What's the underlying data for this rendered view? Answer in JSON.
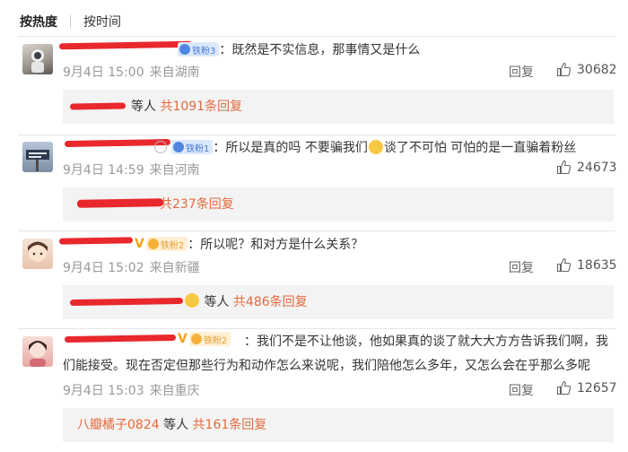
{
  "tabs": [
    {
      "label": "按热度",
      "active": true
    },
    {
      "label": "按时间",
      "active": false
    }
  ],
  "colors": {
    "link": "#e26b3e",
    "redaction": "#e8282d",
    "badge_blue": "#4479d6",
    "badge_gold": "#e39d2d"
  },
  "comments": [
    {
      "badge": "铁粉3",
      "badge_style": "blue",
      "text": "：既然是不实信息，那事情又是什么",
      "date": "9月4日 15:00",
      "location": "来自湖南",
      "reply_label": "回复",
      "likes": "30682",
      "sub": {
        "leading": "",
        "mid": "等人",
        "total": "共1091条回复"
      }
    },
    {
      "badge": "铁粉1",
      "badge_style": "blue",
      "text_a": "：所以是真的吗 不要骗我们",
      "text_b": "谈了不可怕 可怕的是一直骗着粉丝",
      "date": "9月4日 14:59",
      "location": "来自河南",
      "reply_label": "回复",
      "likes": "24673",
      "sub": {
        "leading": "",
        "mid": "",
        "total": "共237条回复"
      }
    },
    {
      "badge": "铁粉2",
      "badge_style": "gold",
      "verified": "V",
      "text": "：所以呢？和对方是什么关系？",
      "date": "9月4日 15:02",
      "location": "来自新疆",
      "reply_label": "回复",
      "likes": "18635",
      "sub": {
        "leading": "",
        "mid": "等人",
        "total": "共486条回复"
      }
    },
    {
      "badge": "铁粉2",
      "badge_style": "gold",
      "verified": "V",
      "text": "：我们不是不让他谈，他如果真的谈了就大大方方告诉我们啊，我们能接受。现在否定但那些行为和动作怎么来说呢，我们陪他怎么多年，又怎么会在乎那么多呢",
      "date": "9月4日 15:03",
      "location": "来自重庆",
      "reply_label": "回复",
      "likes": "12657",
      "sub": {
        "leading": "八瓣橘子0824",
        "mid": "等人",
        "total": "共161条回复"
      }
    }
  ]
}
